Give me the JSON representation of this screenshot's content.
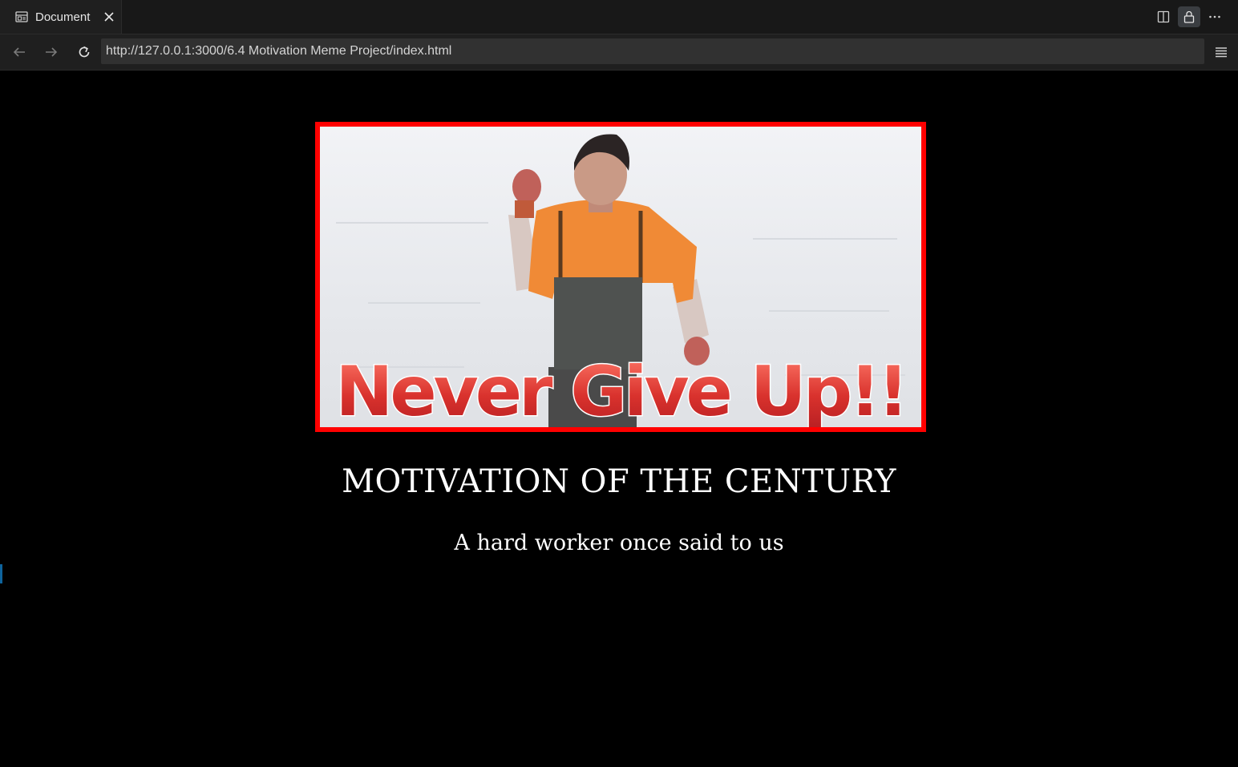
{
  "browser": {
    "tab": {
      "title": "Document",
      "icon": "document-icon"
    },
    "toolbar_icons": [
      "split-view-icon",
      "lock-icon",
      "more-icon"
    ],
    "nav_icons": [
      "back-arrow-icon",
      "forward-arrow-icon",
      "reload-icon",
      "menu-icon"
    ],
    "url": "http://127.0.0.1:3000/6.4 Motivation Meme Project/index.html"
  },
  "page": {
    "image": {
      "caption_text": "Never Give Up!!",
      "border_color": "#ff0000"
    },
    "heading": "MOTIVATION OF THE CENTURY",
    "subheading": "A hard worker once said to us"
  },
  "colors": {
    "background": "#000000",
    "chrome": "#1f1f1f",
    "text": "#ffffff"
  }
}
